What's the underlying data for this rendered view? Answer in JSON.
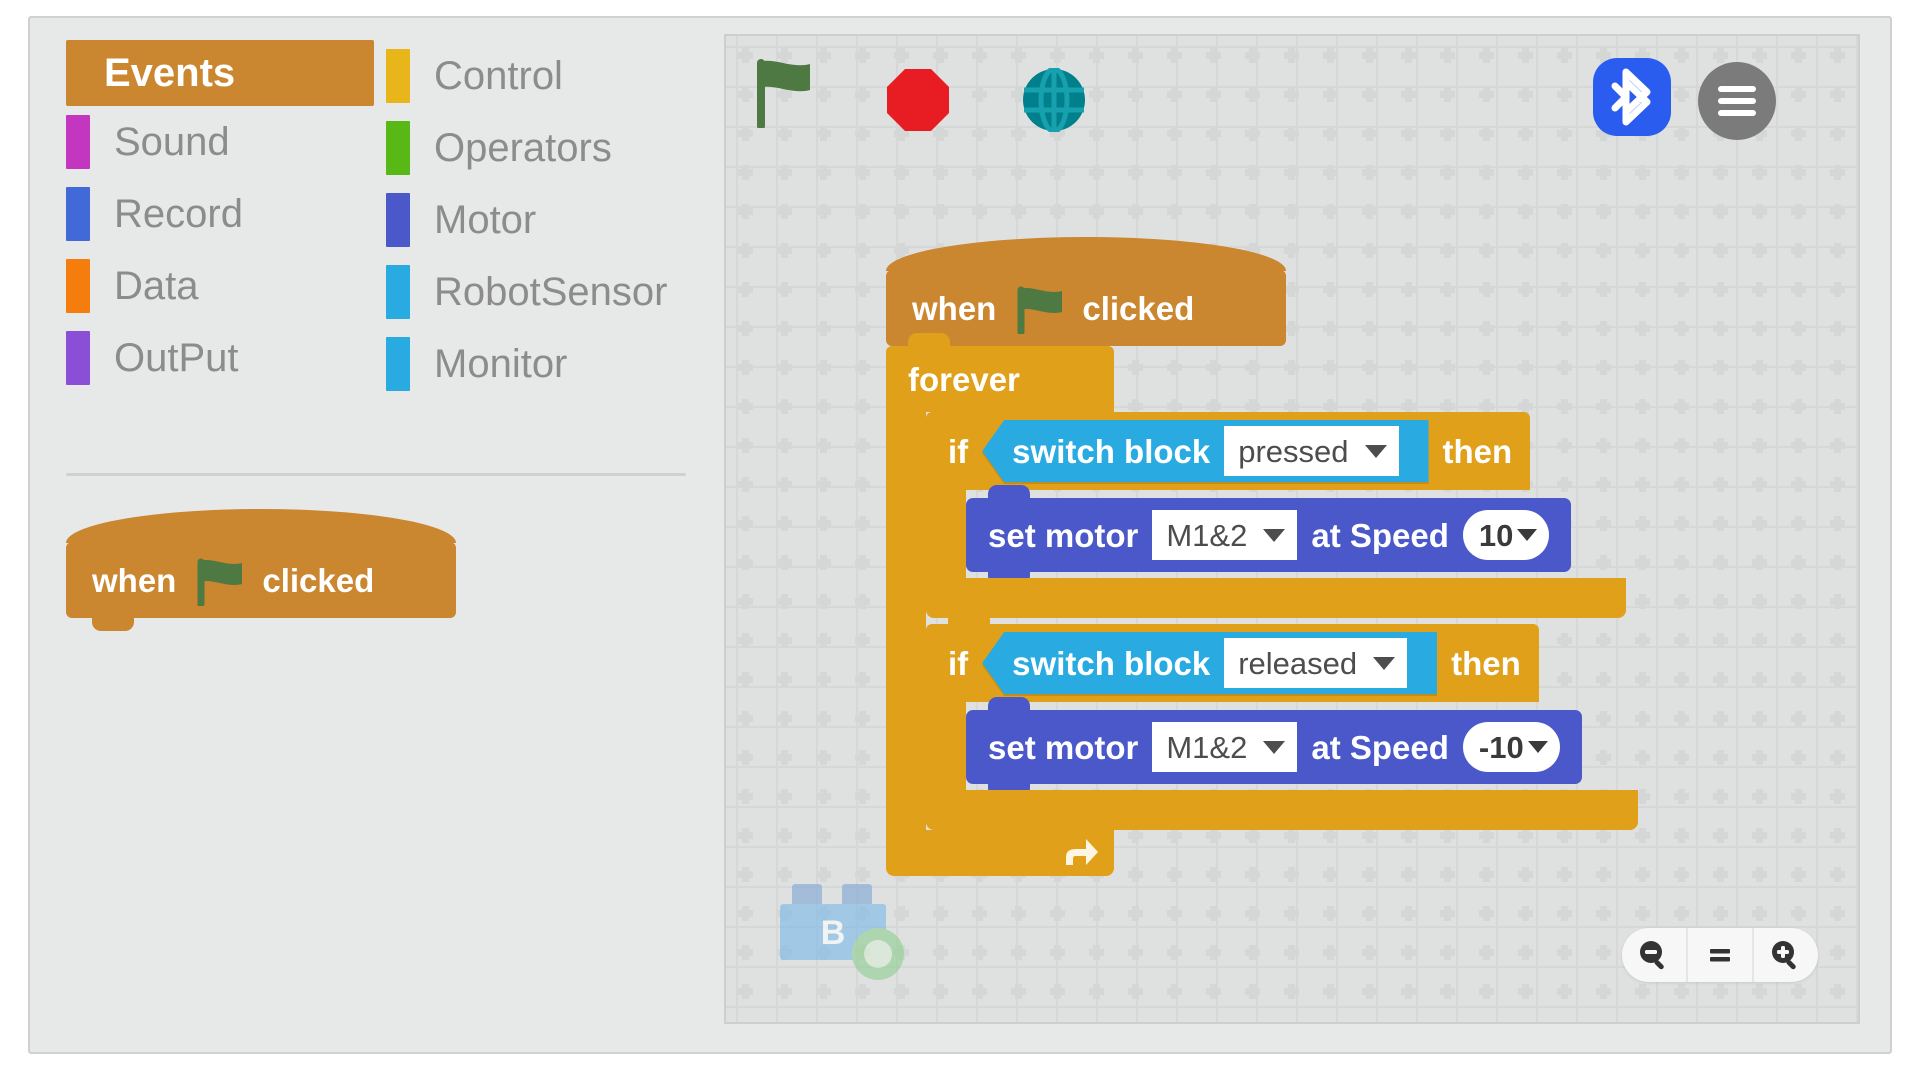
{
  "app": {
    "background": "#e7e9e8",
    "canvas_background": "#dfe1e0"
  },
  "palette": {
    "categories_left": [
      {
        "label": "Events",
        "color": "#cb8630",
        "selected": true
      },
      {
        "label": "Sound",
        "color": "#c236c0",
        "selected": false
      },
      {
        "label": "Record",
        "color": "#4169d8",
        "selected": false
      },
      {
        "label": "Data",
        "color": "#f57d0d",
        "selected": false
      },
      {
        "label": "OutPut",
        "color": "#8a4fd6",
        "selected": false
      }
    ],
    "categories_right": [
      {
        "label": "Control",
        "color": "#e8b51b",
        "selected": false
      },
      {
        "label": "Operators",
        "color": "#58b816",
        "selected": false
      },
      {
        "label": "Motor",
        "color": "#4a58ca",
        "selected": false
      },
      {
        "label": "RobotSensor",
        "color": "#29abe2",
        "selected": false
      },
      {
        "label": "Monitor",
        "color": "#29abe2",
        "selected": false
      }
    ],
    "palette_block": {
      "when": "when",
      "clicked": "clicked",
      "color": "#cb8630",
      "flag_color": "#4f7942"
    }
  },
  "toolbar": {
    "green_flag": {
      "name": "green-flag",
      "color": "#4f7942"
    },
    "stop": {
      "name": "stop-sign",
      "color": "#e81c23"
    },
    "globe": {
      "name": "globe",
      "color": "#00808c"
    },
    "bluetooth": {
      "name": "bluetooth",
      "color": "#2b5cf0"
    },
    "menu": {
      "name": "menu",
      "color": "#7b7b7b"
    }
  },
  "script": {
    "hat": {
      "when": "when",
      "clicked": "clicked",
      "color": "#cb8630"
    },
    "forever": {
      "label": "forever",
      "color": "#e0a019"
    },
    "branches": [
      {
        "if_label": "if",
        "then_label": "then",
        "condition": {
          "label": "switch block",
          "value": "pressed",
          "color": "#29abe2"
        },
        "command": {
          "prefix": "set motor",
          "motor": "M1&2",
          "middle": "at Speed",
          "speed": "10",
          "color": "#4a58ca"
        }
      },
      {
        "if_label": "if",
        "then_label": "then",
        "condition": {
          "label": "switch block",
          "value": "released",
          "color": "#29abe2"
        },
        "command": {
          "prefix": "set motor",
          "motor": "M1&2",
          "middle": "at Speed",
          "speed": "-10",
          "color": "#4a58ca"
        }
      }
    ]
  },
  "brick": {
    "letter": "B",
    "color": "#7cb9e8",
    "badge_color": "#8fcf92"
  },
  "zoom_controls": {
    "zoom_out": "zoom-out",
    "reset": "zoom-reset",
    "zoom_in": "zoom-in"
  }
}
